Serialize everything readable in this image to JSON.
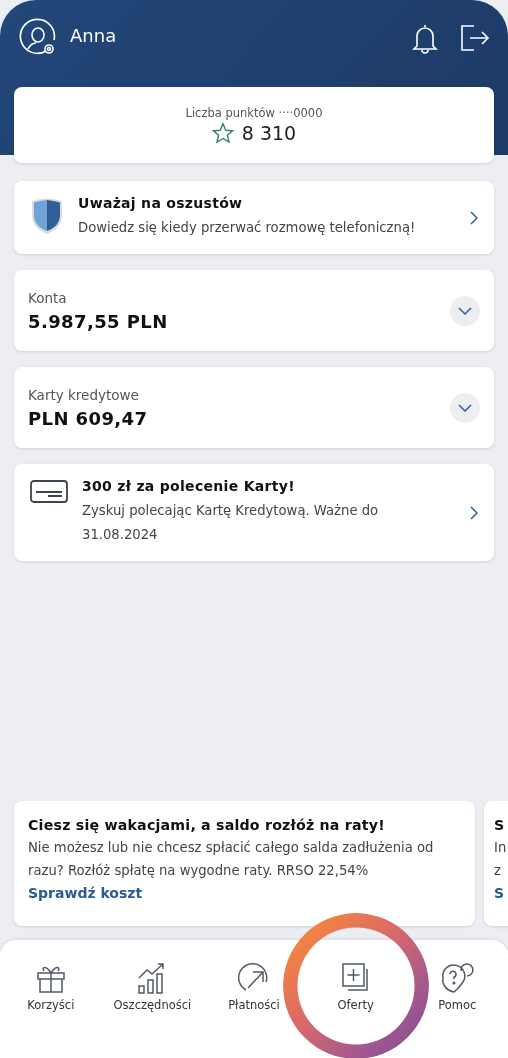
{
  "header": {
    "user_name": "Anna"
  },
  "points": {
    "label": "Liczba punktów ····0000",
    "value": "8 310"
  },
  "cards": [
    {
      "kind": "alert",
      "title": "Uważaj na oszustów",
      "text": "Dowiedz się kiedy przerwać rozmowę telefoniczną!"
    },
    {
      "kind": "balance",
      "label": "Konta",
      "amount": "5.987,55 PLN",
      "expanded": false
    },
    {
      "kind": "balance",
      "label": "Karty kredytowe",
      "amount": "PLN 609,47",
      "expanded": false
    },
    {
      "kind": "promo",
      "title": "300 zł za polecenie Karty!",
      "text": "Zyskuj polecając Kartę Kredytową. Ważne do 31.08.2024"
    }
  ],
  "offers": [
    {
      "title": "Ciesz się wakacjami, a saldo rozłóż na raty!",
      "text_lines": [
        "Nie możesz lub nie chcesz spłacić całego salda zadłużenia od",
        "razu? Rozłóż spłatę na wygodne raty. RRSO 22,54%"
      ],
      "link": "Sprawdź koszt"
    },
    {
      "title": "S",
      "text_lines": [
        "In",
        "z"
      ],
      "link": "S"
    }
  ],
  "nav": [
    {
      "kind": "gift",
      "label": "Korzyści",
      "highlighted": false
    },
    {
      "kind": "chart",
      "label": "Oszczędności",
      "highlighted": false
    },
    {
      "kind": "arrow",
      "label": "Płatności",
      "highlighted": false
    },
    {
      "kind": "offers",
      "label": "Oferty",
      "highlighted": true
    },
    {
      "kind": "help",
      "label": "Pomoc",
      "highlighted": false
    }
  ]
}
